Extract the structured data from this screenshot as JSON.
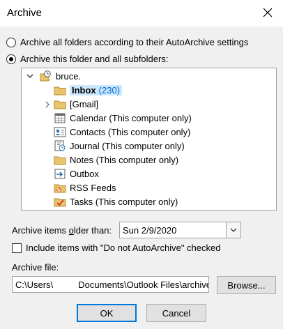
{
  "window": {
    "title": "Archive"
  },
  "options": {
    "archive_all_label": "Archive all folders according to their AutoArchive settings",
    "archive_this_label": "Archive this folder and all subfolders:",
    "selected": "archive_this"
  },
  "tree": {
    "root_label": "bruce.",
    "items": [
      {
        "label": "Inbox",
        "count": "(230)",
        "icon": "inbox-folder-icon",
        "selected": true
      },
      {
        "label": "[Gmail]",
        "icon": "folder-icon",
        "expandable": true
      },
      {
        "label": "Calendar (This computer only)",
        "icon": "calendar-icon"
      },
      {
        "label": "Contacts (This computer only)",
        "icon": "contacts-icon"
      },
      {
        "label": "Journal (This computer only)",
        "icon": "journal-icon"
      },
      {
        "label": "Notes (This computer only)",
        "icon": "notes-icon"
      },
      {
        "label": "Outbox",
        "icon": "outbox-icon"
      },
      {
        "label": "RSS Feeds",
        "icon": "rss-feeds-icon"
      },
      {
        "label": "Tasks (This computer only)",
        "icon": "tasks-icon"
      }
    ]
  },
  "archive_older": {
    "label": "Archive items older than:",
    "value": "Sun 2/9/2020"
  },
  "include_do_not": {
    "label": "Include items with \"Do not AutoArchive\" checked",
    "checked": false
  },
  "archive_file": {
    "label": "Archive file:",
    "value": "C:\\Users\\          Documents\\Outlook Files\\archive"
  },
  "buttons": {
    "browse": "Browse...",
    "ok": "OK",
    "cancel": "Cancel"
  },
  "colors": {
    "accent": "#0078d7",
    "selection": "#cce8ff",
    "count": "#0066cc",
    "folder": "#e8c46a"
  }
}
